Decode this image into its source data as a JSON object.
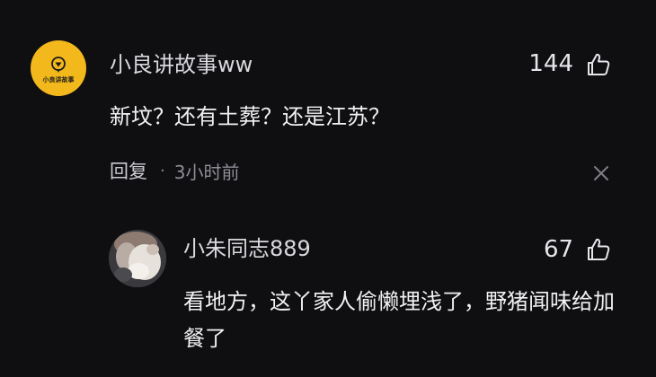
{
  "main_comment": {
    "avatar_text": "小良讲故事",
    "username": "小良讲故事ww",
    "likes": "144",
    "text": "新坟？还有土葬？还是江苏？",
    "reply_label": "回复",
    "separator": "·",
    "time": "3小时前"
  },
  "reply_comment": {
    "username": "小朱同志889",
    "likes": "67",
    "text": "看地方，这丫家人偷懒埋浅了，野猪闻味给加餐了"
  },
  "icons": {
    "like": "thumbs-up-icon",
    "close": "close-icon"
  },
  "colors": {
    "background": "#0f0f12",
    "avatar_accent": "#f3b81c"
  }
}
